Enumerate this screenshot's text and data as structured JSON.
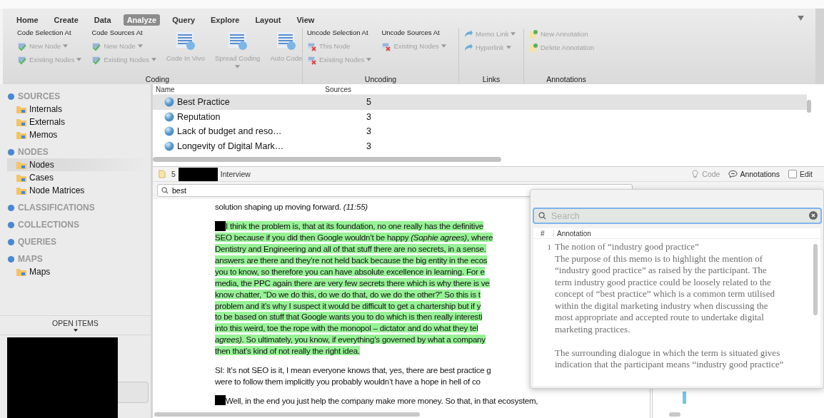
{
  "ribbon": {
    "tabs": [
      {
        "label": "Home",
        "selected": false
      },
      {
        "label": "Create",
        "selected": false
      },
      {
        "label": "Data",
        "selected": false
      },
      {
        "label": "Analyze",
        "selected": true
      },
      {
        "label": "Query",
        "selected": false
      },
      {
        "label": "Explore",
        "selected": false
      },
      {
        "label": "Layout",
        "selected": false
      },
      {
        "label": "View",
        "selected": false
      }
    ],
    "groups": [
      {
        "label": "Coding",
        "columns": [
          {
            "kind": "stack",
            "header": "Code Selection At",
            "items": [
              {
                "label": "New Node",
                "dropdown": true,
                "disabled": true
              },
              {
                "label": "Existing Nodes",
                "dropdown": true,
                "disabled": true
              }
            ]
          },
          {
            "kind": "stack",
            "header": "Code Sources At",
            "items": [
              {
                "label": "New Node",
                "dropdown": true,
                "disabled": true
              },
              {
                "label": "Existing Nodes",
                "dropdown": true,
                "disabled": true
              }
            ]
          },
          {
            "kind": "large",
            "label": "Code In Vivo",
            "dropdown": false,
            "disabled": true
          },
          {
            "kind": "large",
            "label": "Spread Coding",
            "dropdown": true,
            "disabled": true
          },
          {
            "kind": "large",
            "label": "Auto Code",
            "dropdown": false,
            "disabled": true
          }
        ]
      },
      {
        "label": "Uncoding",
        "columns": [
          {
            "kind": "stack",
            "header": "Uncode Selection At",
            "items": [
              {
                "label": "This Node",
                "dropdown": false,
                "disabled": true
              },
              {
                "label": "Existing Nodes",
                "dropdown": true,
                "disabled": true
              }
            ]
          },
          {
            "kind": "stack",
            "header": "Uncode Sources At",
            "items": [
              {
                "label": "Existing Nodes",
                "dropdown": true,
                "disabled": true
              }
            ]
          }
        ]
      },
      {
        "label": "Links",
        "columns": [
          {
            "kind": "stack",
            "items": [
              {
                "label": "Memo Link",
                "dropdown": true,
                "disabled": true
              },
              {
                "label": "Hyperlink",
                "dropdown": true,
                "disabled": true
              }
            ]
          }
        ]
      },
      {
        "label": "Annotations",
        "columns": [
          {
            "kind": "stack",
            "items": [
              {
                "label": "New Annotation",
                "dropdown": false,
                "disabled": true
              },
              {
                "label": "Delete Annotation",
                "dropdown": false,
                "disabled": true
              }
            ]
          }
        ]
      }
    ]
  },
  "sidebar": {
    "sections": [
      {
        "label": "SOURCES",
        "children": [
          {
            "label": "Internals",
            "selected": false
          },
          {
            "label": "Externals",
            "selected": false
          },
          {
            "label": "Memos",
            "selected": false
          }
        ]
      },
      {
        "label": "NODES",
        "children": [
          {
            "label": "Nodes",
            "selected": true
          },
          {
            "label": "Cases",
            "selected": false
          },
          {
            "label": "Node Matrices",
            "selected": false
          }
        ]
      },
      {
        "label": "CLASSIFICATIONS"
      },
      {
        "label": "COLLECTIONS"
      },
      {
        "label": "QUERIES"
      },
      {
        "label": "MAPS",
        "children": [
          {
            "label": "Maps",
            "selected": false
          }
        ]
      }
    ],
    "open_items": "OPEN ITEMS"
  },
  "table": {
    "columns": [
      "Name",
      "Sources"
    ],
    "rows": [
      {
        "name": "Best Practice",
        "sources": "5",
        "selected": true
      },
      {
        "name": "Reputation",
        "sources": "3",
        "selected": false
      },
      {
        "name": "Lack of budget and reso…",
        "sources": "3",
        "selected": false
      },
      {
        "name": "Longevity of Digital Mark…",
        "sources": "3",
        "selected": false
      }
    ]
  },
  "document": {
    "number": "5",
    "title": "Interview",
    "buttons": [
      {
        "label": "Code",
        "disabled": true
      },
      {
        "label": "Annotations",
        "disabled": false
      }
    ],
    "edit": {
      "label": "Edit",
      "checked": false
    },
    "search": {
      "value": "best"
    },
    "paragraphs": [
      {
        "highlighted": false,
        "redacted": false,
        "lines": [
          "solution shaping up moving forward. *(11:55)*"
        ]
      },
      {
        "highlighted": true,
        "redacted": true,
        "lines": [
          "I think the problem is, that at its foundation, no one really has the definitive",
          "SEO because if you did then Google wouldn’t be happy *(Sophie agrees)*, where",
          "Dentistry and Engineering and all of that stuff there are no secrets, in a sense.",
          "answers are there and they’re not held back because the big entity in the ecos",
          "you to know, so therefore you can have absolute excellence in learning.  For e",
          "media, the PPC again there are very few secrets there which is why there is ve",
          "know chatter, “Do we do this, do we do that, do we do the other?” So this is t",
          "problem and it’s why I suspect it would be difficult to get a chartership but if y",
          "to be based on stuff that Google wants you to do which is then really interesti",
          "into this weird, toe the rope with the monopol – dictator and do what they tel",
          "*agrees)*.  So ultimately, you know, if everything’s governed by what a company",
          "then that’s kind of not really the right idea."
        ]
      },
      {
        "highlighted": false,
        "redacted": false,
        "lines": [
          "SI: It’s not SEO is it, I mean everyone knows that, yes, there are best practice g",
          "were to follow them implicitly you probably wouldn’t have a hope in hell of co"
        ]
      },
      {
        "highlighted": false,
        "redacted": true,
        "lines": [
          "Well, in the end you just help the company make more money.  So that, in that ecosystem,"
        ]
      }
    ]
  },
  "annotations": {
    "search": {
      "placeholder": "Search"
    },
    "columns": [
      "#",
      "Annotation"
    ],
    "rows": [
      {
        "number": "1",
        "title": "The notion of “industry good practice”",
        "paragraphs": [
          "The purpose of this memo is to highlight the mention of “industry good practice” as raised by the participant. The term industry good practice could be loosely related to the concept of “best practice” which is a common term utilised within the digital marketing industry when discussing the most appropriate and accepted route to undertake digital marketing practices.",
          "The surrounding dialogue in which the term is situated gives indication that the participant means “industry good practice”"
        ]
      }
    ]
  }
}
